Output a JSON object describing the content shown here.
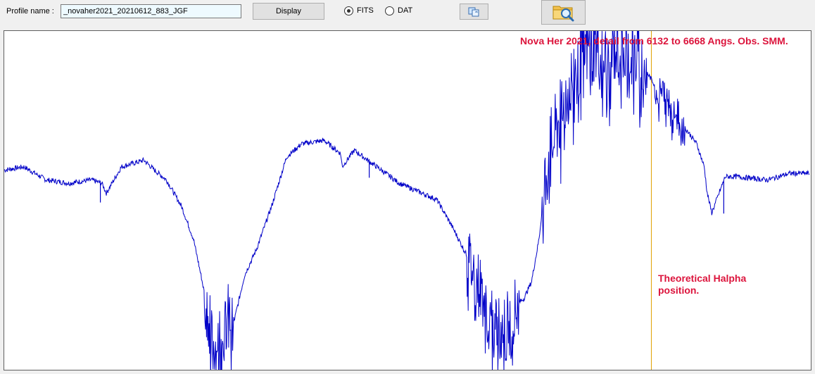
{
  "toolbar": {
    "profile_label": "Profile name :",
    "profile_value": "_novaher2021_20210612_883_JGF",
    "display_label": "Display",
    "copy_icon": "copy-icon",
    "folder_icon": "folder-search-icon",
    "format_options": [
      {
        "label": "FITS",
        "selected": true
      },
      {
        "label": "DAT",
        "selected": false
      }
    ]
  },
  "plot": {
    "title": "Nova Her 2021, detail from 6132 to 6668 Angs. Obs. SMM.",
    "marker_label": "Theoretical Halpha position.",
    "colors": {
      "trace": "#0000c8",
      "marker": "#e0a000",
      "annotation": "#dc143c"
    }
  },
  "chart_data": {
    "type": "line",
    "title": "Nova Her 2021, detail from 6132 to 6668 Angs. Obs. SMM.",
    "xlabel": "",
    "ylabel": "",
    "xlim": [
      6132,
      6668
    ],
    "ylim": [
      0,
      1
    ],
    "grid": false,
    "markers": [
      {
        "x": 6562.8,
        "label": "Theoretical Halpha position."
      }
    ],
    "series": [
      {
        "x": [
          6132,
          6145,
          6160,
          6175,
          6190,
          6197,
          6200,
          6210,
          6225,
          6232,
          6240,
          6250,
          6258,
          6263,
          6268,
          6271,
          6273,
          6276,
          6279,
          6281,
          6285,
          6292,
          6300,
          6310,
          6320,
          6330,
          6345,
          6356,
          6357,
          6365,
          6380,
          6395,
          6410,
          6420,
          6430,
          6440,
          6450,
          6455,
          6460,
          6465,
          6469,
          6473,
          6478,
          6483,
          6488,
          6492,
          6495,
          6500,
          6505,
          6510,
          6517,
          6525,
          6532,
          6540,
          6550,
          6558,
          6565,
          6575,
          6585,
          6593,
          6598,
          6600,
          6603,
          6612,
          6620,
          6640,
          6655,
          6668
        ],
        "values": [
          0.59,
          0.6,
          0.56,
          0.55,
          0.56,
          0.55,
          0.52,
          0.6,
          0.62,
          0.59,
          0.56,
          0.48,
          0.38,
          0.27,
          0.15,
          0.05,
          0.08,
          0.12,
          0.1,
          0.15,
          0.13,
          0.27,
          0.35,
          0.48,
          0.63,
          0.67,
          0.68,
          0.64,
          0.6,
          0.65,
          0.6,
          0.55,
          0.52,
          0.5,
          0.42,
          0.33,
          0.22,
          0.14,
          0.13,
          0.12,
          0.14,
          0.18,
          0.2,
          0.25,
          0.38,
          0.55,
          0.65,
          0.72,
          0.8,
          0.87,
          0.95,
          0.97,
          0.92,
          0.97,
          0.95,
          0.9,
          0.85,
          0.8,
          0.72,
          0.67,
          0.6,
          0.52,
          0.46,
          0.57,
          0.57,
          0.56,
          0.58,
          0.58
        ]
      }
    ]
  }
}
